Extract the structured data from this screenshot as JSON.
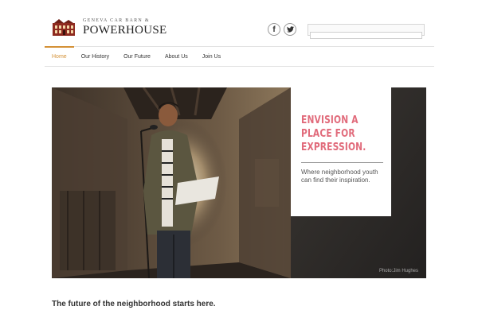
{
  "header": {
    "logo_top": "GENEVA CAR BARN &",
    "logo_main": "POWERHOUSE",
    "social": [
      {
        "icon": "facebook-icon",
        "glyph": "f"
      },
      {
        "icon": "twitter-icon",
        "glyph": "t"
      }
    ],
    "search": {
      "value": "",
      "placeholder": ""
    }
  },
  "nav": {
    "items": [
      {
        "label": "Home",
        "active": true
      },
      {
        "label": "Our History"
      },
      {
        "label": "Our Future"
      },
      {
        "label": "About Us"
      },
      {
        "label": "Join Us"
      }
    ]
  },
  "hero": {
    "headline": "ENVISION A PLACE FOR EXPRESSION.",
    "subtext": "Where neighborhood youth can find their inspiration.",
    "credit": "Photo:Jim Hughes"
  },
  "tagline": "The future of the neighborhood starts here.",
  "colors": {
    "accent": "#d49136",
    "headline": "#e16b7b",
    "logo_building": "#8e2a1f"
  }
}
